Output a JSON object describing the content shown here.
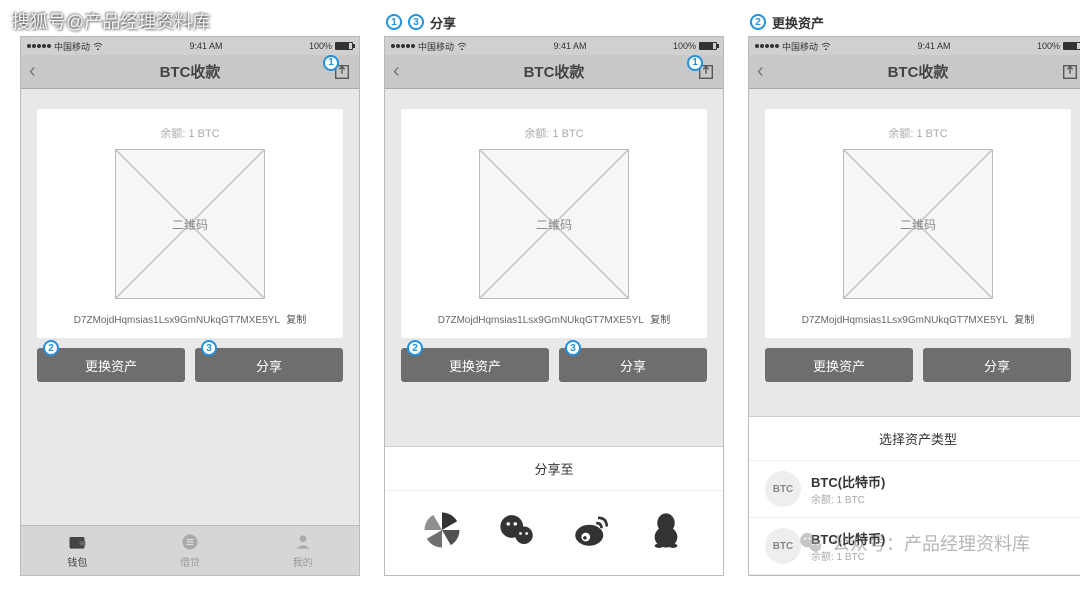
{
  "watermarks": {
    "top_left": "搜狐号@产品经理资料库",
    "bottom_right_prefix": "公众号：",
    "bottom_right_name": "产品经理资料库"
  },
  "annotations": {
    "col2_label": "分享",
    "col3_label": "更换资产"
  },
  "statusbar": {
    "carrier": "中国移动",
    "time": "9:41 AM",
    "battery": "100%"
  },
  "navbar": {
    "title": "BTC收款"
  },
  "card": {
    "balance_label": "余额: 1 BTC",
    "qr_label": "二维码",
    "address": "D7ZMojdHqmsias1Lsx9GmNUkqGT7MXE5YL",
    "copy_label": "复制"
  },
  "buttons": {
    "switch_asset": "更换资产",
    "share": "分享"
  },
  "tabs": {
    "wallet": "钱包",
    "loan": "借贷",
    "mine": "我的"
  },
  "share_sheet": {
    "title": "分享至"
  },
  "asset_sheet": {
    "title": "选择资产类型",
    "items": [
      {
        "symbol": "BTC",
        "name": "BTC(比特币)",
        "balance": "余额: 1 BTC"
      },
      {
        "symbol": "BTC",
        "name": "BTC(比特币)",
        "balance": "余额: 1 BTC"
      }
    ]
  }
}
